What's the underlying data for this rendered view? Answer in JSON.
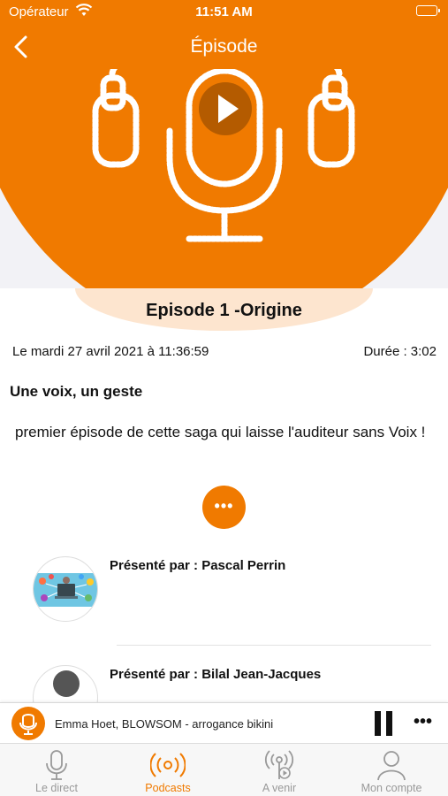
{
  "status_bar": {
    "carrier": "Opérateur",
    "time": "11:51 AM",
    "battery_level": 1.0
  },
  "nav": {
    "title": "Épisode",
    "back_icon": "chevron-left-icon"
  },
  "hero": {
    "artwork_icon": "microphone-headphones-icon",
    "play_icon": "play-icon"
  },
  "episode": {
    "title": "Episode 1 -Origine",
    "date": "Le mardi 27 avril 2021 à 11:36:59",
    "duration": "Durée : 3:02",
    "subtitle": "Une voix, un geste",
    "description": "premier épisode de cette saga qui laisse l'auditeur sans Voix !",
    "more_label": "•••"
  },
  "presenters": [
    {
      "label": "Présenté par : Pascal Perrin"
    },
    {
      "label": "Présenté par : Bilal Jean-Jacques"
    }
  ],
  "mini_player": {
    "track": "Emma Hoet, BLOWSOM - arrogance bikini",
    "more_label": "•••"
  },
  "tabs": [
    {
      "label": "Le direct",
      "icon": "microphone-icon",
      "active": false
    },
    {
      "label": "Podcasts",
      "icon": "broadcast-icon",
      "active": true
    },
    {
      "label": "A venir",
      "icon": "podcast-play-icon",
      "active": false
    },
    {
      "label": "Mon compte",
      "icon": "user-icon",
      "active": false
    }
  ],
  "colors": {
    "accent": "#f07a00",
    "background": "#ffffff",
    "tab_inactive": "#999999"
  }
}
